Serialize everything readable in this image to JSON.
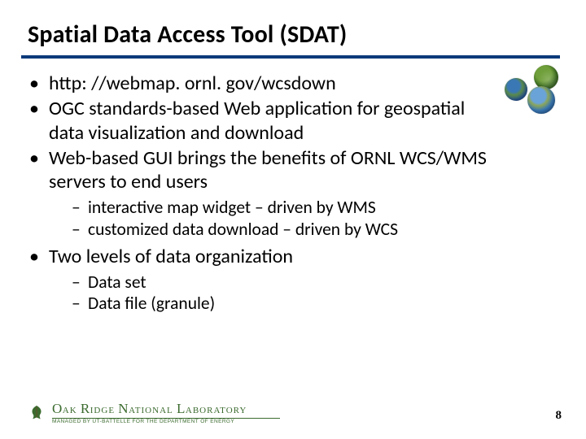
{
  "title": "Spatial Data Access Tool (SDAT)",
  "bullets": {
    "b1": "http: //webmap. ornl. gov/wcsdown",
    "b2": "OGC standards-based Web application for geospatial data visualization and download",
    "b3": "Web-based GUI brings the benefits of ORNL WCS/WMS servers to end users",
    "b3_sub1": "interactive map widget – driven by WMS",
    "b3_sub2": "customized data download – driven by WCS",
    "b4": "Two levels of data organization",
    "b4_sub1": "Data set",
    "b4_sub2": "Data file (granule)"
  },
  "footer": {
    "lab_name_html": "OAK RIDGE NATIONAL LABORATORY",
    "lab_managed": "MANAGED BY UT-BATTELLE FOR THE DEPARTMENT OF ENERGY"
  },
  "page_number": "8"
}
